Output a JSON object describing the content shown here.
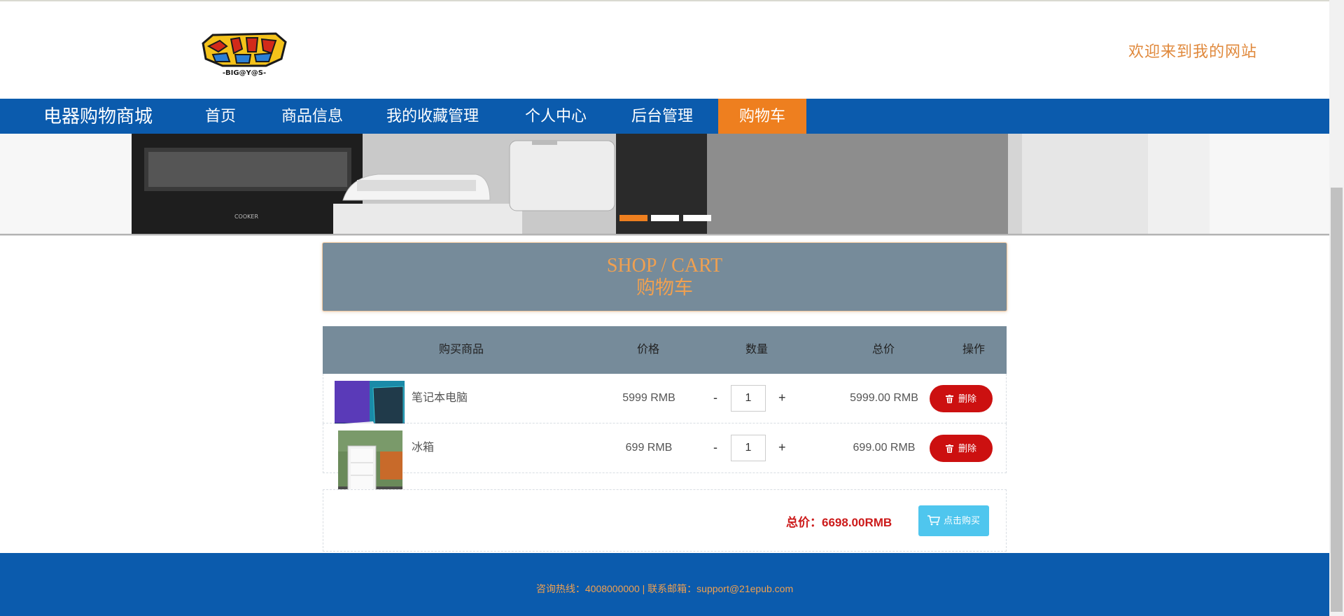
{
  "header": {
    "welcome": "欢迎来到我的网站",
    "logo_alt": "DIGIMON BIG@Y@S"
  },
  "nav": {
    "brand": "电器购物商城",
    "items": [
      {
        "label": "首页"
      },
      {
        "label": "商品信息"
      },
      {
        "label": "我的收藏管理"
      },
      {
        "label": "个人中心"
      },
      {
        "label": "后台管理"
      },
      {
        "label": "购物车",
        "active": true
      }
    ]
  },
  "banner": {
    "dots": 3,
    "active_dot": 1
  },
  "title": {
    "en": "SHOP / CART",
    "cn": "购物车"
  },
  "table": {
    "headers": [
      "购买商品",
      "价格",
      "数量",
      "总价",
      "操作"
    ],
    "rows": [
      {
        "name": "笔记本电脑",
        "price": "5999 RMB",
        "qty": "1",
        "total": "5999.00 RMB",
        "action": "删除"
      },
      {
        "name": "冰箱",
        "price": "699 RMB",
        "qty": "1",
        "total": "699.00 RMB",
        "action": "删除"
      }
    ],
    "minus": "-",
    "plus": "+"
  },
  "summary": {
    "total_label": "总价：6698.00RMB",
    "buy_label": "点击购买"
  },
  "footer": {
    "text": "咨询热线：4008000000 | 联系邮箱：support@21epub.com"
  },
  "colors": {
    "nav_bg": "#0b5bad",
    "accent": "#ee7f1f",
    "danger": "#cc1010",
    "buy": "#4fc6ee",
    "panel": "#768b9a"
  }
}
